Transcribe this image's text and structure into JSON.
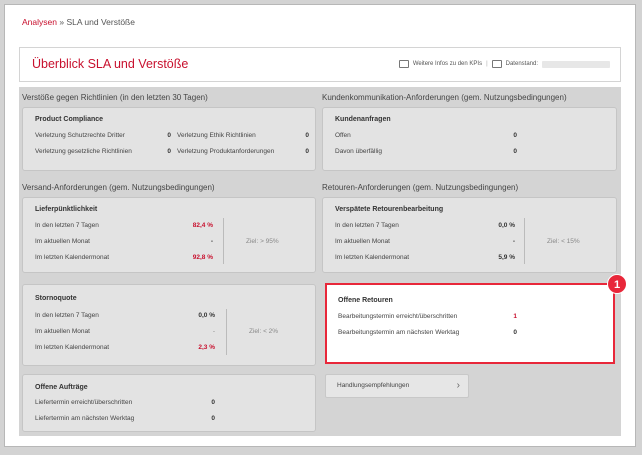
{
  "breadcrumb": {
    "link": "Analysen",
    "separator": "»",
    "current": "SLA und Verstöße"
  },
  "header": {
    "title": "Überblick SLA und Verstöße",
    "kpi_info": "Weitere Infos zu den KPIs",
    "date_label": "Datenstand:"
  },
  "sections": {
    "policy": "Verstöße gegen Richtlinien (in den letzten 30 Tagen)",
    "customer": "Kundenkommunikation-Anforderungen (gem. Nutzungsbedingungen)",
    "shipping": "Versand-Anforderungen (gem. Nutzungsbedingungen)",
    "returns": "Retouren-Anforderungen (gem. Nutzungsbedingungen)"
  },
  "product_compliance": {
    "title": "Product Compliance",
    "rows": [
      {
        "label": "Verletzung Schutzrechte Dritter",
        "value": "0"
      },
      {
        "label": "Verletzung gesetzliche Richtlinien",
        "value": "0"
      },
      {
        "label": "Verletzung Ethik Richtlinien",
        "value": "0"
      },
      {
        "label": "Verletzung Produktanforderungen",
        "value": "0"
      }
    ]
  },
  "customer_requests": {
    "title": "Kundenanfragen",
    "rows": [
      {
        "label": "Offen",
        "value": "0"
      },
      {
        "label": "Davon überfällig",
        "value": "0"
      }
    ]
  },
  "delivery": {
    "title": "Lieferpünktlichkeit",
    "rows": [
      {
        "label": "In den letzten 7 Tagen",
        "value": "82,4 %"
      },
      {
        "label": "Im aktuellen Monat",
        "value": "-"
      },
      {
        "label": "Im letzten Kalendermonat",
        "value": "92,8 %"
      }
    ],
    "goal": "Ziel: > 95%"
  },
  "late_returns": {
    "title": "Verspätete Retourenbearbeitung",
    "rows": [
      {
        "label": "In den letzten 7 Tagen",
        "value": "0,0 %"
      },
      {
        "label": "Im aktuellen Monat",
        "value": "-"
      },
      {
        "label": "Im letzten Kalendermonat",
        "value": "5,9 %"
      }
    ],
    "goal": "Ziel: < 15%"
  },
  "cancellation": {
    "title": "Stornoquote",
    "rows": [
      {
        "label": "In den letzten 7 Tagen",
        "value": "0,0 %"
      },
      {
        "label": "Im aktuellen Monat",
        "value": "-"
      },
      {
        "label": "Im letzten Kalendermonat",
        "value": "2,3 %"
      }
    ],
    "goal": "Ziel: < 2%"
  },
  "open_returns": {
    "title": "Offene Retouren",
    "rows": [
      {
        "label": "Bearbeitungstermin erreicht/überschritten",
        "value": "1"
      },
      {
        "label": "Bearbeitungstermin am nächsten Werktag",
        "value": "0"
      }
    ]
  },
  "open_orders": {
    "title": "Offene Aufträge",
    "rows": [
      {
        "label": "Liefertermin erreicht/überschritten",
        "value": "0"
      },
      {
        "label": "Liefertermin am nächsten Werktag",
        "value": "0"
      }
    ]
  },
  "actions": {
    "label": "Handlungsempfehlungen"
  },
  "callout": {
    "number": "1"
  },
  "colors": {
    "accent": "#c8102e",
    "callout": "#e8273a"
  }
}
